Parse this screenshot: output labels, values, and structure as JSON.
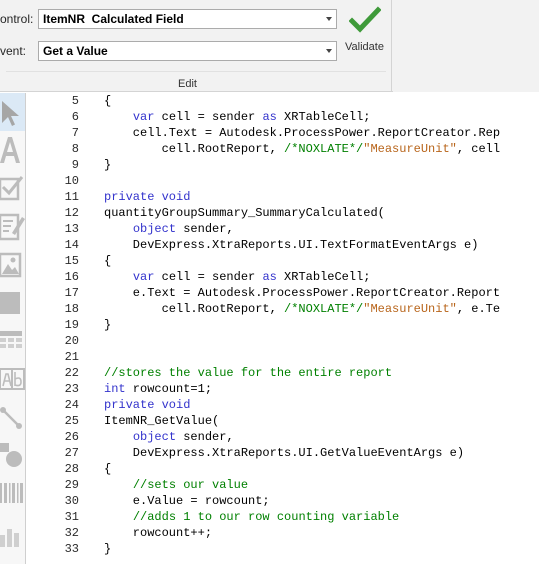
{
  "ribbon": {
    "control_label": "ontrol:",
    "control_value": "ItemNR  Calculated Field",
    "event_label": "vent:",
    "event_value": "Get a Value",
    "validate_label": "Validate",
    "group_caption": "Edit",
    "accent_check_color": "#3f9a3a"
  },
  "toolbox": {
    "items": [
      "pointer-icon",
      "label-icon",
      "checkbox-icon",
      "rich-text-icon",
      "picture-icon",
      "panel-icon",
      "table-icon",
      "character-comb-icon",
      "line-icon",
      "shape-icon",
      "barcode-icon"
    ]
  },
  "editor": {
    "lines": [
      {
        "n": "5",
        "tokens": [
          {
            "t": "pl",
            "v": "{"
          }
        ]
      },
      {
        "n": "6",
        "tokens": [
          {
            "t": "pl",
            "v": "    "
          },
          {
            "t": "kw",
            "v": "var"
          },
          {
            "t": "pl",
            "v": " cell = sender "
          },
          {
            "t": "kw",
            "v": "as"
          },
          {
            "t": "pl",
            "v": " XRTableCell;"
          }
        ]
      },
      {
        "n": "7",
        "tokens": [
          {
            "t": "pl",
            "v": "    cell.Text = Autodesk.ProcessPower.ReportCreator.Rep"
          }
        ]
      },
      {
        "n": "8",
        "tokens": [
          {
            "t": "pl",
            "v": "        cell.RootReport, "
          },
          {
            "t": "cm",
            "v": "/*NOXLATE*/"
          },
          {
            "t": "str",
            "v": "\"MeasureUnit\""
          },
          {
            "t": "pl",
            "v": ", cell"
          }
        ]
      },
      {
        "n": "9",
        "tokens": [
          {
            "t": "pl",
            "v": "}"
          }
        ]
      },
      {
        "n": "10",
        "tokens": []
      },
      {
        "n": "11",
        "tokens": [
          {
            "t": "kw",
            "v": "private void"
          }
        ]
      },
      {
        "n": "12",
        "tokens": [
          {
            "t": "pl",
            "v": "quantityGroupSummary_SummaryCalculated("
          }
        ]
      },
      {
        "n": "13",
        "tokens": [
          {
            "t": "pl",
            "v": "    "
          },
          {
            "t": "kw",
            "v": "object"
          },
          {
            "t": "pl",
            "v": " sender,"
          }
        ]
      },
      {
        "n": "14",
        "tokens": [
          {
            "t": "pl",
            "v": "    DevExpress.XtraReports.UI.TextFormatEventArgs e)"
          }
        ]
      },
      {
        "n": "15",
        "tokens": [
          {
            "t": "pl",
            "v": "{"
          }
        ]
      },
      {
        "n": "16",
        "tokens": [
          {
            "t": "pl",
            "v": "    "
          },
          {
            "t": "kw",
            "v": "var"
          },
          {
            "t": "pl",
            "v": " cell = sender "
          },
          {
            "t": "kw",
            "v": "as"
          },
          {
            "t": "pl",
            "v": " XRTableCell;"
          }
        ]
      },
      {
        "n": "17",
        "tokens": [
          {
            "t": "pl",
            "v": "    e.Text = Autodesk.ProcessPower.ReportCreator.Report"
          }
        ]
      },
      {
        "n": "18",
        "tokens": [
          {
            "t": "pl",
            "v": "        cell.RootReport, "
          },
          {
            "t": "cm",
            "v": "/*NOXLATE*/"
          },
          {
            "t": "str",
            "v": "\"MeasureUnit\""
          },
          {
            "t": "pl",
            "v": ", e.Te"
          }
        ]
      },
      {
        "n": "19",
        "tokens": [
          {
            "t": "pl",
            "v": "}"
          }
        ]
      },
      {
        "n": "20",
        "tokens": []
      },
      {
        "n": "21",
        "tokens": []
      },
      {
        "n": "22",
        "tokens": [
          {
            "t": "cm",
            "v": "//stores the value for the entire report"
          }
        ]
      },
      {
        "n": "23",
        "tokens": [
          {
            "t": "kw",
            "v": "int"
          },
          {
            "t": "pl",
            "v": " rowcount=1;"
          }
        ]
      },
      {
        "n": "24",
        "tokens": [
          {
            "t": "kw",
            "v": "private void"
          }
        ]
      },
      {
        "n": "25",
        "tokens": [
          {
            "t": "pl",
            "v": "ItemNR_GetValue("
          }
        ]
      },
      {
        "n": "26",
        "tokens": [
          {
            "t": "pl",
            "v": "    "
          },
          {
            "t": "kw",
            "v": "object"
          },
          {
            "t": "pl",
            "v": " sender,"
          }
        ]
      },
      {
        "n": "27",
        "tokens": [
          {
            "t": "pl",
            "v": "    DevExpress.XtraReports.UI.GetValueEventArgs e)"
          }
        ]
      },
      {
        "n": "28",
        "tokens": [
          {
            "t": "pl",
            "v": "{"
          }
        ]
      },
      {
        "n": "29",
        "tokens": [
          {
            "t": "pl",
            "v": "    "
          },
          {
            "t": "cm",
            "v": "//sets our value"
          }
        ]
      },
      {
        "n": "30",
        "tokens": [
          {
            "t": "pl",
            "v": "    e.Value = rowcount;"
          }
        ]
      },
      {
        "n": "31",
        "tokens": [
          {
            "t": "pl",
            "v": "    "
          },
          {
            "t": "cm",
            "v": "//adds 1 to our row counting variable"
          }
        ]
      },
      {
        "n": "32",
        "tokens": [
          {
            "t": "pl",
            "v": "    rowcount++;"
          }
        ]
      },
      {
        "n": "33",
        "tokens": [
          {
            "t": "pl",
            "v": "}"
          }
        ]
      }
    ]
  }
}
